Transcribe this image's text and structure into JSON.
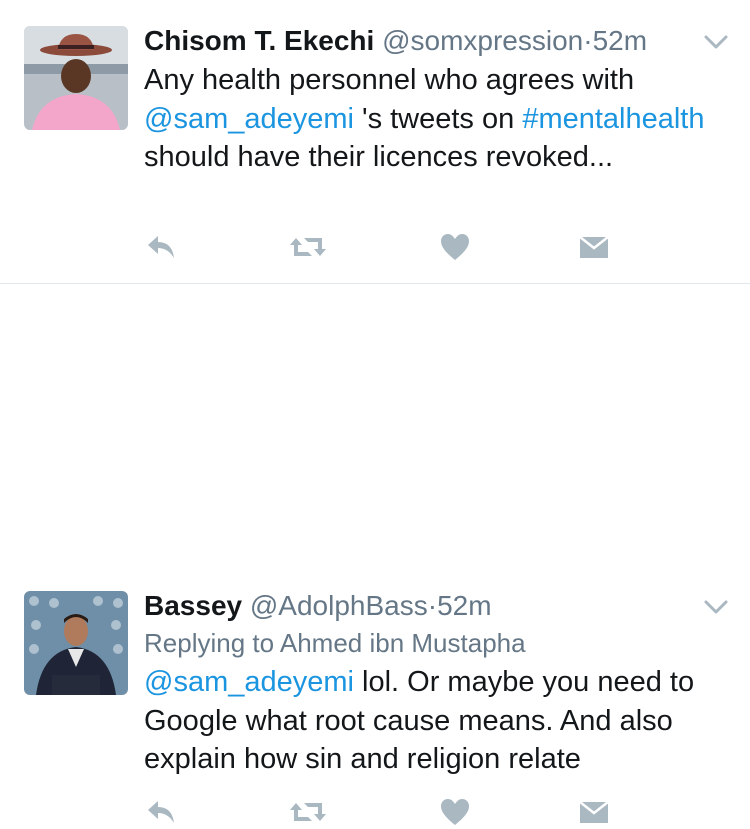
{
  "tweets": [
    {
      "name": "Chisom T. Ekechi",
      "handle": "@somxpression",
      "separator": "·",
      "time": "52m",
      "text_parts": [
        {
          "t": "Any health personnel who agrees with "
        },
        {
          "t": "@sam_adeyemi",
          "link": true
        },
        {
          "t": " 's tweets on "
        },
        {
          "t": "#mentalhealth",
          "link": true
        },
        {
          "t": " should have their licences revoked..."
        }
      ]
    },
    {
      "name": "Bassey",
      "handle": "@AdolphBass",
      "separator": "·",
      "time": "52m",
      "reply_to": "Replying to Ahmed ibn Mustapha",
      "text_parts": [
        {
          "t": "@sam_adeyemi",
          "link": true
        },
        {
          "t": " lol. Or maybe you need to Google what root cause means. And also explain how sin and religion relate"
        }
      ]
    }
  ],
  "icons": {
    "reply": "reply-icon",
    "retweet": "retweet-icon",
    "like": "heart-icon",
    "dm": "envelope-icon",
    "more": "chevron-down-icon"
  },
  "colors": {
    "link": "#1b95e0",
    "muted": "#657786",
    "icon": "#aab8c2",
    "text": "#14171a"
  }
}
